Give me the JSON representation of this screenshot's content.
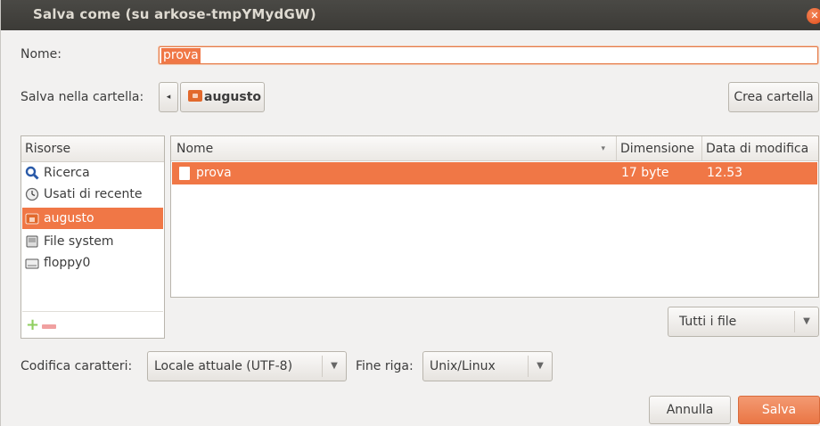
{
  "window": {
    "title": "Salva come (su arkose-tmpYMydGW)",
    "close_icon": "close-icon"
  },
  "name_row": {
    "label": "Nome:",
    "value": "prova"
  },
  "folder_row": {
    "label": "Salva nella cartella:",
    "back_glyph": "◂",
    "current_folder": "augusto",
    "create_folder_label": "Crea cartella"
  },
  "places": {
    "header": "Risorse",
    "items": [
      {
        "label": "Ricerca",
        "icon": "search-icon"
      },
      {
        "label": "Usati di recente",
        "icon": "clock-icon"
      },
      {
        "label": "augusto",
        "icon": "home-folder-icon",
        "selected": true
      },
      {
        "label": "File system",
        "icon": "drive-icon"
      },
      {
        "label": "floppy0",
        "icon": "floppy-icon"
      }
    ]
  },
  "files": {
    "columns": [
      "Nome",
      "Dimensione",
      "Data di modifica"
    ],
    "rows": [
      {
        "name": "prova",
        "size": "17 byte",
        "modified": "12.53",
        "selected": true
      }
    ]
  },
  "filter": {
    "value": "Tutti i file"
  },
  "encoding": {
    "label": "Codifica caratteri:",
    "value": "Locale attuale (UTF-8)"
  },
  "line_ending": {
    "label": "Fine riga:",
    "value": "Unix/Linux"
  },
  "buttons": {
    "cancel": "Annulla",
    "save": "Salva"
  },
  "colors": {
    "accent": "#f07746",
    "titlebar": "#3c3b37"
  }
}
